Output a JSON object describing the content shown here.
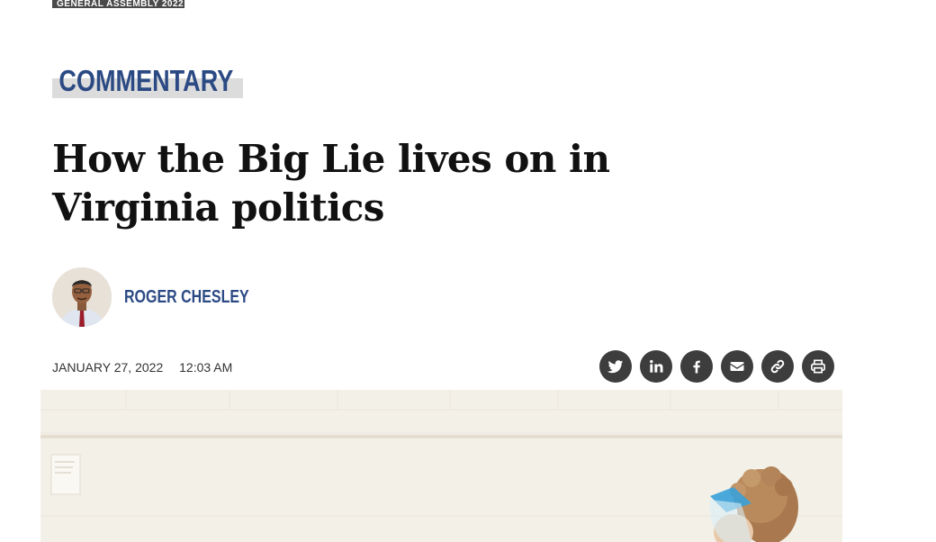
{
  "top_tag": "GENERAL ASSEMBLY 2022",
  "kicker": "COMMENTARY",
  "headline": "How the Big Lie lives on in Virginia politics",
  "author": {
    "name": "ROGER CHESLEY"
  },
  "meta": {
    "date": "JANUARY 27, 2022",
    "time": "12:03 AM"
  },
  "share": {
    "icons": [
      "twitter-icon",
      "linkedin-icon",
      "facebook-icon",
      "email-icon",
      "link-icon",
      "print-icon"
    ],
    "color": "#3d3d3d"
  },
  "colors": {
    "accent": "#2b4a84",
    "kicker_highlight": "#dcdcdc",
    "headline": "#111111"
  }
}
